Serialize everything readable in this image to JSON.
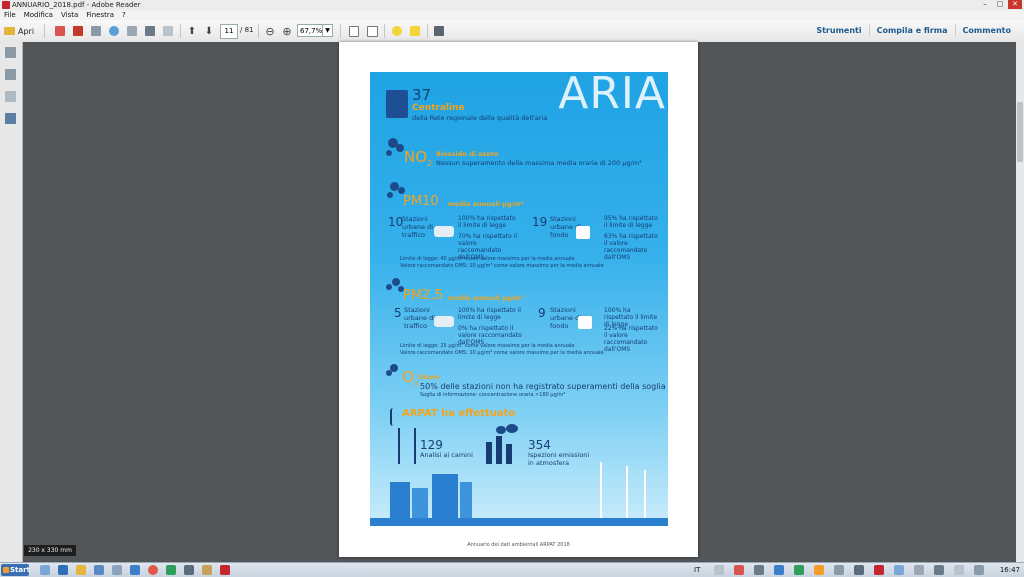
{
  "window": {
    "title": "ANNUARIO_2018.pdf - Adobe Reader"
  },
  "menu": [
    "File",
    "Modifica",
    "Vista",
    "Finestra",
    "?"
  ],
  "toolbar": {
    "open_label": "Apri",
    "page_current": "11",
    "page_total": "/ 81",
    "zoom": "67,7%",
    "right_links": [
      "Strumenti",
      "Compila e firma",
      "Commento"
    ]
  },
  "poster": {
    "heading": "ARIA",
    "stations": {
      "count": "37",
      "title": "Centraline",
      "subtitle": "della Rete regionale della qualità dell'aria"
    },
    "no2": {
      "symbol": "NO",
      "sub": "2",
      "name": "Biossido di azoto",
      "text": "Nessun superamento della massima media oraria di 200 µg/m³"
    },
    "pm10": {
      "symbol": "PM10",
      "unit": "media annuali µg/m³",
      "traffic": {
        "count": "10",
        "label": "Stazioni urbane di traffico",
        "legal_pct": "100",
        "legal_text": "% ha rispettato il limite di legge",
        "oms_pct": "70",
        "oms_text": "% ha rispettato il valore raccomandato dall'OMS"
      },
      "background": {
        "count": "19",
        "label": "Stazioni urbane di fondo",
        "legal_pct": "95",
        "legal_text": "% ha rispettato il limite di legge",
        "oms_pct": "63",
        "oms_text": "% ha rispettato il valore raccomandato dall'OMS"
      },
      "note1": "Limite di legge: 40 µg/m³ come valore massimo per la media annuale",
      "note2": "Valore raccomandato OMS: 20 µg/m³ come valore massimo per la media annuale"
    },
    "pm25": {
      "symbol": "PM2,5",
      "unit": "medie annuali µg/m³",
      "traffic": {
        "count": "5",
        "label": "Stazioni urbane di traffico",
        "legal_pct": "100",
        "legal_text": "% ha rispettato il limite di legge",
        "oms_pct": "0",
        "oms_text": "% ha rispettato il valore raccomandato dall'OMS"
      },
      "background": {
        "count": "9",
        "label": "Stazioni urbane di fondo",
        "legal_pct": "100",
        "legal_text": "% ha rispettato il limite di legge",
        "oms_pct": "22",
        "oms_text": "% ha rispettato il valore raccomandato dall'OMS"
      },
      "note1": "Limite di legge: 25 µg/m³ come valore massimo per la media annuale",
      "note2": "Valore raccomandato OMS: 10 µg/m³ come valore massimo per la media annuale"
    },
    "o3": {
      "symbol": "O",
      "sub": "3",
      "name": "Ozono",
      "pct": "50",
      "text": "% delle stazioni non ha registrato superamenti della soglia di informazione",
      "note": "Soglia di informazione: concentrazione oraria >180 µg/m³"
    },
    "arpat": {
      "title": "ARPAT ha effettuato",
      "analyses_count": "129",
      "analyses_label": "Analisi ai camini",
      "inspections_count": "354",
      "inspections_label1": "Ispezioni emissioni",
      "inspections_label2": "in atmosfera"
    }
  },
  "page_footer": "Annuario dei dati ambientali ARPAT 2018",
  "dimensions_label": "230 x 330 mm",
  "taskbar": {
    "start_label": "Start",
    "lang": "IT",
    "clock": "16:47"
  }
}
